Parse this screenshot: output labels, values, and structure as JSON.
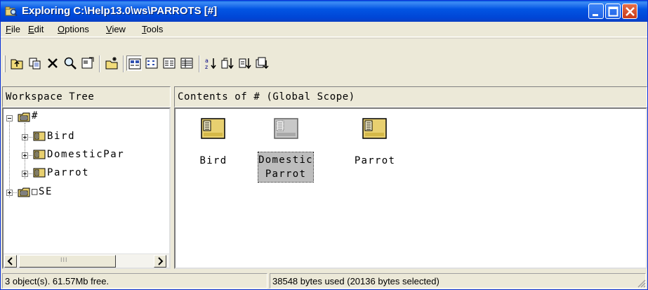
{
  "window": {
    "title": "Exploring C:\\Help13.0\\ws\\PARROTS [#]"
  },
  "menu": [
    {
      "label": "File",
      "u": "F",
      "rest": "ile"
    },
    {
      "label": "Edit",
      "u": "E",
      "rest": "dit"
    },
    {
      "label": "Options",
      "u": "O",
      "rest": "ptions"
    },
    {
      "label": "View",
      "u": "V",
      "rest": "iew"
    },
    {
      "label": "Tools",
      "u": "T",
      "rest": "ools"
    }
  ],
  "toolbar": {
    "buttons": [
      "up-folder",
      "copy",
      "delete",
      "find",
      "properties",
      "new",
      "large-icons",
      "small-icons",
      "list",
      "details",
      "sort-by-name",
      "sort-by-type",
      "sort-by-size",
      "sort-by-date"
    ]
  },
  "tree": {
    "header": "Workspace Tree",
    "root": "#",
    "children": [
      "Bird",
      "DomesticPar",
      "Parrot"
    ],
    "second_root": "□SE",
    "scroll_thumb_grip": "III"
  },
  "contents": {
    "header": "Contents of # (Global Scope)",
    "items": [
      {
        "line1": "Bird",
        "line2": ""
      },
      {
        "line1": "Domestic",
        "line2": "Parrot"
      },
      {
        "line1": "Parrot",
        "line2": ""
      }
    ]
  },
  "status": {
    "left": "3 object(s). 61.57Mb free.",
    "right": "38548 bytes used (20136 bytes selected)"
  }
}
